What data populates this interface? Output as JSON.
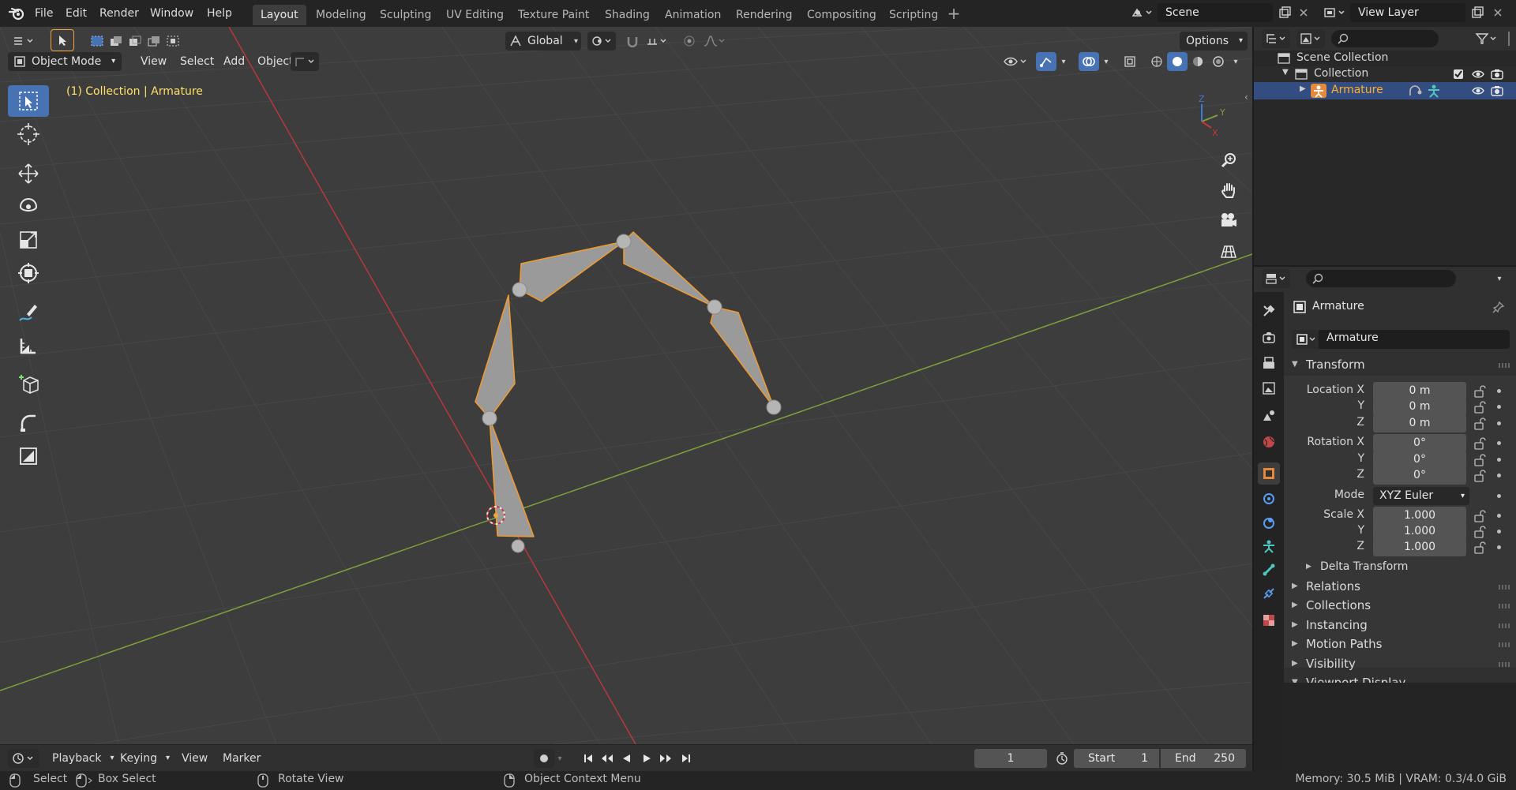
{
  "menu": [
    "File",
    "Edit",
    "Render",
    "Window",
    "Help"
  ],
  "workspaces": [
    "Layout",
    "Modeling",
    "Sculpting",
    "UV Editing",
    "Texture Paint",
    "Shading",
    "Animation",
    "Rendering",
    "Compositing",
    "Scripting"
  ],
  "active_workspace": "Layout",
  "scene": {
    "name": "Scene",
    "view_layer": "View Layer"
  },
  "viewport": {
    "mode": "Object Mode",
    "menus": [
      "View",
      "Select",
      "Add",
      "Object"
    ],
    "orientation": "Global",
    "options_label": "Options",
    "context_info": "(1) Collection | Armature",
    "gizmo_axes": [
      "Z",
      "Y",
      "X"
    ]
  },
  "outliner": {
    "root": "Scene Collection",
    "collection": "Collection",
    "object": "Armature"
  },
  "properties": {
    "object_name": "Armature",
    "data_name": "Armature",
    "transform_title": "Transform",
    "rows": [
      {
        "label": "Location X",
        "value": "0 m"
      },
      {
        "label": "Y",
        "value": "0 m"
      },
      {
        "label": "Z",
        "value": "0 m"
      },
      {
        "label": "Rotation X",
        "value": "0°"
      },
      {
        "label": "Y",
        "value": "0°"
      },
      {
        "label": "Z",
        "value": "0°"
      },
      {
        "label": "Scale X",
        "value": "1.000"
      },
      {
        "label": "Y",
        "value": "1.000"
      },
      {
        "label": "Z",
        "value": "1.000"
      }
    ],
    "mode_label": "Mode",
    "mode_value": "XYZ Euler",
    "delta": "Delta Transform",
    "panels": [
      "Relations",
      "Collections",
      "Instancing",
      "Motion Paths",
      "Visibility",
      "Viewport Display"
    ]
  },
  "timeline": {
    "menus": [
      "Playback",
      "Keying",
      "View",
      "Marker"
    ],
    "current_frame": "1",
    "start_label": "Start",
    "start": "1",
    "end_label": "End",
    "end": "250"
  },
  "status": {
    "select": "Select",
    "box_select": "Box Select",
    "rotate_view": "Rotate View",
    "context_menu": "Object Context Menu",
    "memory": "Memory: 30.5 MiB | VRAM: 0.3/4.0 GiB"
  },
  "colors": {
    "accent": "#4772b3",
    "selected_outline": "#f29b2d",
    "x_axis": "#c23b3b",
    "y_axis": "#7fa83a",
    "context_text": "#ffe16b"
  }
}
